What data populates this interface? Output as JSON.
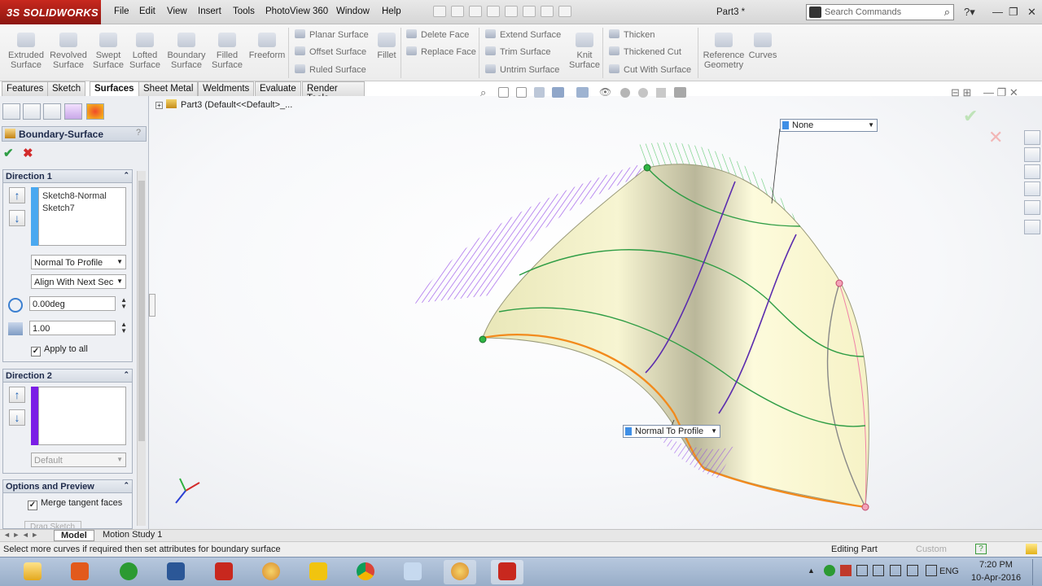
{
  "app": {
    "logo_text": "SOLIDWORKS",
    "logo_prefix": "3S",
    "document_title": "Part3 *"
  },
  "menu": [
    "File",
    "Edit",
    "View",
    "Insert",
    "Tools",
    "PhotoView 360",
    "Window",
    "Help"
  ],
  "search": {
    "placeholder": "Search Commands"
  },
  "ribbon": {
    "big_buttons": [
      {
        "label": "Extruded\nSurface"
      },
      {
        "label": "Revolved\nSurface"
      },
      {
        "label": "Swept\nSurface"
      },
      {
        "label": "Lofted\nSurface"
      },
      {
        "label": "Boundary\nSurface"
      },
      {
        "label": "Filled\nSurface"
      },
      {
        "label": "Freeform"
      }
    ],
    "group1": [
      "Planar Surface",
      "Offset Surface",
      "Ruled Surface"
    ],
    "fillet": "Fillet",
    "group2": [
      "Delete Face",
      "Replace Face"
    ],
    "group3": [
      "Extend Surface",
      "Trim Surface",
      "Untrim Surface"
    ],
    "knit": "Knit\nSurface",
    "group4": [
      "Thicken",
      "Thickened Cut",
      "Cut With Surface"
    ],
    "reference_geometry": "Reference\nGeometry",
    "curves": "Curves"
  },
  "command_tabs": [
    "Features",
    "Sketch",
    "Surfaces",
    "Sheet Metal",
    "Weldments",
    "Evaluate",
    "Render Tools"
  ],
  "active_tab": "Surfaces",
  "tree": {
    "root": "Part3  (Default<<Default>_..."
  },
  "property_manager": {
    "title": "Boundary-Surface",
    "help": "?",
    "direction1": {
      "header": "Direction 1",
      "items": [
        "Sketch8-Normal",
        "Sketch7"
      ],
      "tangency": "Normal To Profile",
      "align": "Align With Next Sec",
      "angle": "0.00deg",
      "length": "1.00",
      "apply_all": "Apply to all",
      "color": "#4aa8f0"
    },
    "direction2": {
      "header": "Direction 2",
      "tangency": "Default",
      "color": "#7b1ee6"
    },
    "options": {
      "header": "Options and Preview",
      "merge": "Merge tangent faces",
      "cut_text": "Drag Sketch"
    }
  },
  "callouts": {
    "top": "None",
    "bottom": "Normal To Profile"
  },
  "bottom_tabs": [
    "Model",
    "Motion Study 1"
  ],
  "status": {
    "message": "Select more curves if required then set attributes for boundary surface",
    "mode": "Editing Part",
    "units": "Custom"
  },
  "tray": {
    "lang": "ENG",
    "time": "7:20 PM",
    "date": "10-Apr-2016"
  }
}
